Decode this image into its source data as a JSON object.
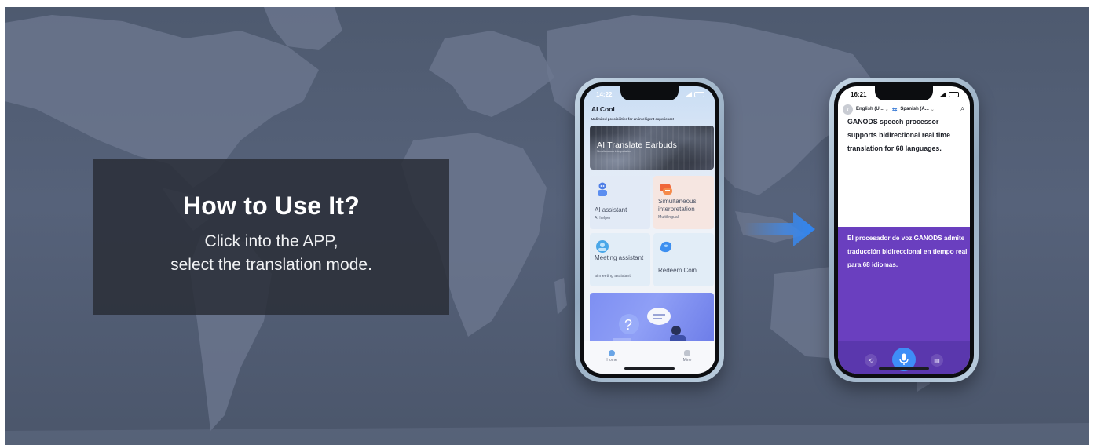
{
  "info": {
    "title": "How to Use It?",
    "line1": "Click into the APP,",
    "line2": "select the translation mode."
  },
  "phone1": {
    "time": "14:22",
    "app_title": "AI Cool",
    "app_subtitle": "Unlimited possibilities for an intelligent experience!",
    "hero": {
      "title": "AI Translate Earbuds",
      "subtitle": "Simultaneous interpretation"
    },
    "cards": [
      {
        "label": "AI assistant",
        "sub": "AI helper",
        "icon": "robot-icon"
      },
      {
        "label": "Simultaneous interpretation",
        "sub": "Multilingual",
        "icon": "chat-bubble-icon"
      },
      {
        "label": "Meeting assistant",
        "sub": "ai meeting assistant",
        "icon": "meeting-icon"
      },
      {
        "label": "Redeem Coin",
        "sub": "",
        "icon": "coin-icon"
      }
    ],
    "tabs": [
      {
        "label": "Home"
      },
      {
        "label": "Mine"
      }
    ]
  },
  "phone2": {
    "time": "16:21",
    "source_lang": "English (U...",
    "target_lang": "Spanish (A...",
    "source_text": "GANODS speech processor supports bidirectional real time translation for 68 languages.",
    "target_text": "El procesador de voz GANODS admite traducción bidireccional en tiempo real para 68 idiomas."
  },
  "colors": {
    "banner_bg": "#525d73",
    "info_box": "#2c3039",
    "translation_panel": "#6a3fbf",
    "mic_button": "#3e8ef7",
    "arrow": "#3d8bf0"
  }
}
